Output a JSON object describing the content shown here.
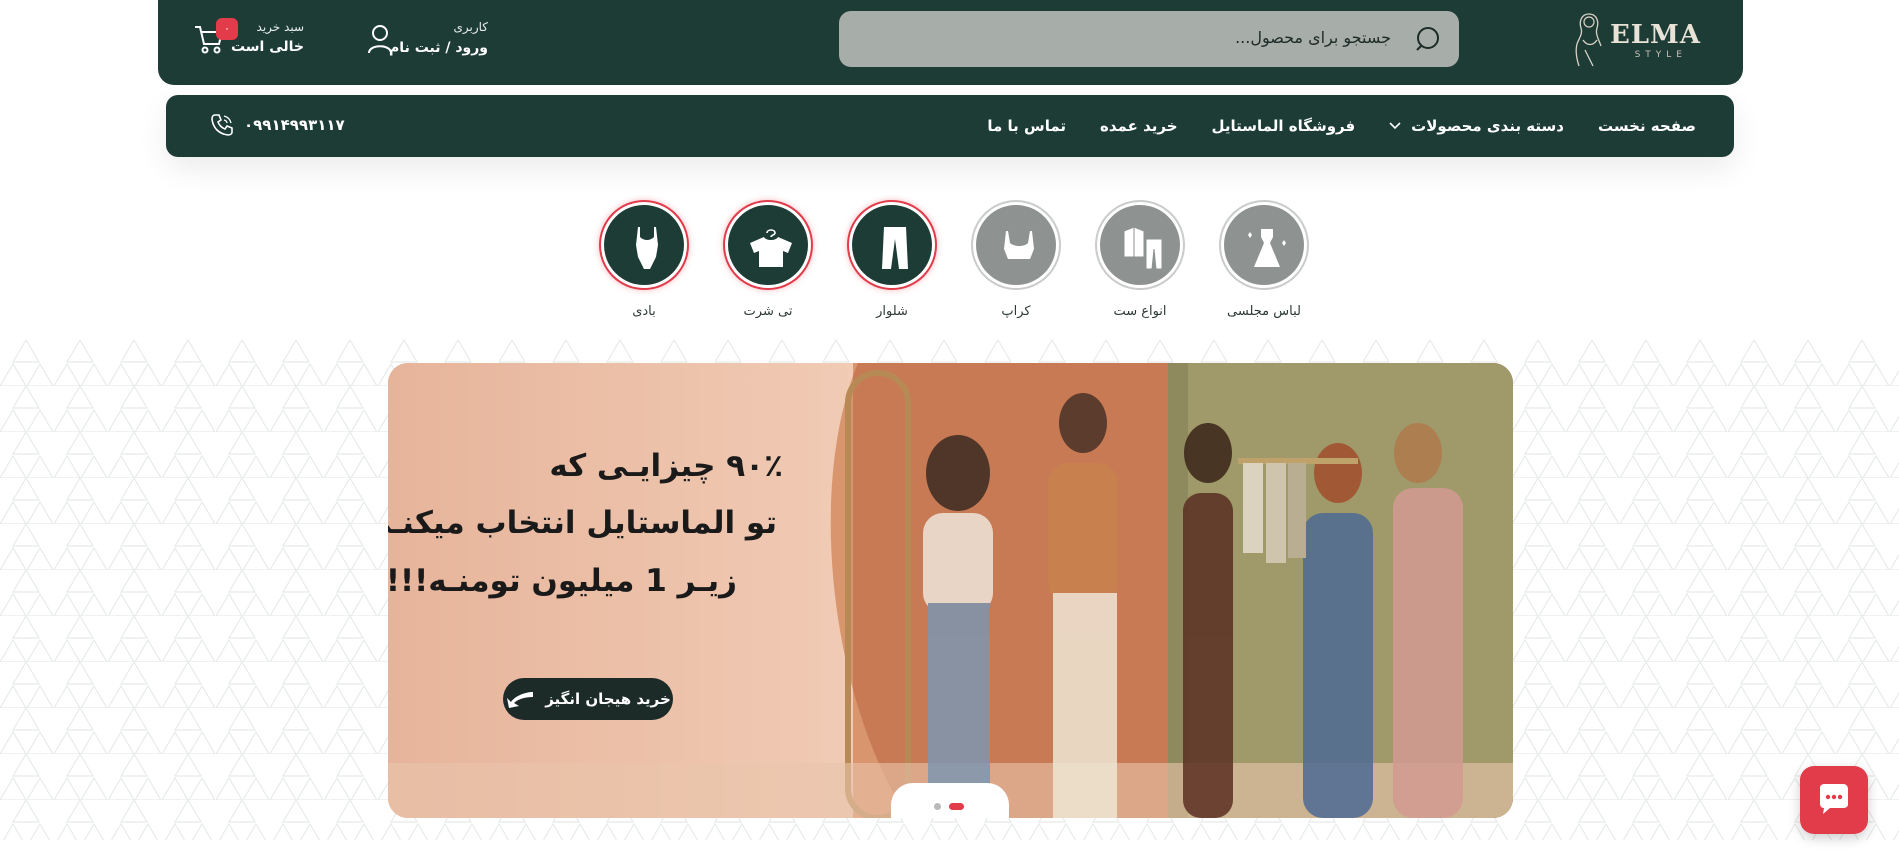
{
  "brand": {
    "name": "ELMA",
    "tagline": "STYLE"
  },
  "search": {
    "placeholder": "جستجو برای محصول..."
  },
  "account": {
    "label": "کاربری",
    "link": "ورود / ثبت نام"
  },
  "cart": {
    "label": "سبد خرید",
    "status": "خالی است",
    "count": "۰"
  },
  "nav": {
    "items": [
      {
        "label": "صفحه نخست"
      },
      {
        "label": "دسته بندی محصولات"
      },
      {
        "label": "فروشگاه الماستایل"
      },
      {
        "label": "خرید عمده"
      },
      {
        "label": "تماس با ما"
      }
    ],
    "phone": "۰۹۹۱۴۹۹۳۱۱۷"
  },
  "categories": [
    {
      "label": "لباس مجلسی",
      "icon": "dress-icon",
      "style": "gray"
    },
    {
      "label": "انواع ست",
      "icon": "suit-set-icon",
      "style": "gray"
    },
    {
      "label": "کراپ",
      "icon": "crop-top-icon",
      "style": "gray"
    },
    {
      "label": "شلوار",
      "icon": "pants-icon",
      "style": "dark"
    },
    {
      "label": "تی شرت",
      "icon": "tshirt-icon",
      "style": "dark"
    },
    {
      "label": "بادی",
      "icon": "bodysuit-icon",
      "style": "dark"
    }
  ],
  "banner": {
    "line1": "۹۰٪ چیزایـی که",
    "line2": "تو الماستایل انتخاب میکنـی",
    "line3": "زیـر 1 میلیون تومنـه!!!",
    "cta": "خرید هیجان انگیز",
    "slides": 2,
    "active_slide": 2
  },
  "colors": {
    "primary": "#1d3c36",
    "accent": "#e23b4a",
    "search_bg": "#a7ada9"
  }
}
